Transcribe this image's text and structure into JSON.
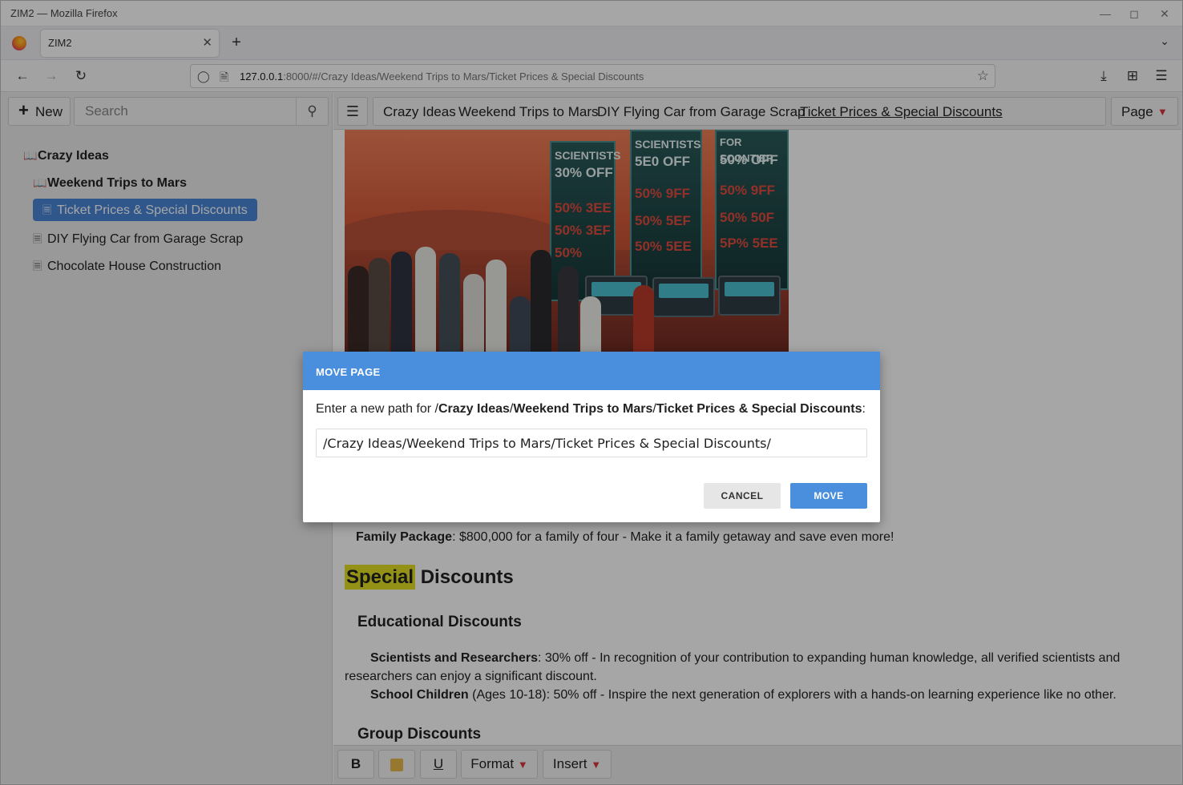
{
  "window": {
    "title": "ZIM2 — Mozilla Firefox"
  },
  "browser": {
    "tab_title": "ZIM2",
    "url_host": "127.0.0.1",
    "url_rest": ":8000/#/Crazy Ideas/Weekend Trips to Mars/Ticket Prices & Special Discounts"
  },
  "sidebar": {
    "new_label": "New",
    "search_placeholder": "Search",
    "tree": [
      {
        "label": "Crazy Ideas"
      },
      {
        "label": "Weekend Trips to Mars"
      },
      {
        "label": "Ticket Prices & Special Discounts"
      },
      {
        "label": "DIY Flying Car from Garage Scrap"
      },
      {
        "label": "Chocolate House Construction"
      }
    ]
  },
  "breadcrumbs": [
    "Crazy Ideas",
    "Weekend Trips to Mars",
    "DIY Flying Car from Garage Scrap",
    "Ticket Prices & Special Discounts"
  ],
  "page_menu_label": "Page",
  "hero_image": {
    "panels": [
      {
        "header": "SCIENTISTS",
        "lines": [
          "30% OFF",
          "50% 3EE",
          "50% 3EF",
          "50%"
        ]
      },
      {
        "header": "SCIENTISTS",
        "lines": [
          "5E0 OFF",
          "50% 9FF",
          "50% 5EF",
          "50% 5EE"
        ]
      },
      {
        "header": "FOR SCONTIER",
        "lines": [
          "50% OFF",
          "50% 9FF",
          "50% 50F",
          "5P% 5EE"
        ]
      }
    ]
  },
  "content": {
    "family_label": "Family Package",
    "family_text": ": $800,000 for a family of four - Make it a family getaway and save even more!",
    "h1_highlight": "Special",
    "h1_rest": " Discounts",
    "h2_edu": "Educational Discounts",
    "sci_label": "Scientists and Researchers",
    "sci_text": ": 30% off - In recognition of your contribution to expanding human knowledge, all verified scientists and researchers can enjoy a significant discount.",
    "school_label": "School Children",
    "school_text": " (Ages 10-18): 50% off - Inspire the next generation of explorers with a hands-on learning experience like no other.",
    "h2_group": "Group Discounts"
  },
  "toolbar": {
    "bold": "B",
    "underline": "U",
    "format": "Format",
    "insert": "Insert"
  },
  "dialog": {
    "title": "MOVE PAGE",
    "prompt_prefix": "Enter a new path for /",
    "prompt_p1": "Crazy Ideas",
    "prompt_sep1": "/",
    "prompt_p2": "Weekend Trips to Mars",
    "prompt_sep2": "/",
    "prompt_p3": "Ticket Prices & Special Discounts",
    "prompt_suffix": ":",
    "path_value": "/Crazy Ideas/Weekend Trips to Mars/Ticket Prices & Special Discounts/",
    "cancel": "CANCEL",
    "move": "MOVE"
  },
  "colors": {
    "accent": "#4a8ede",
    "selected_item": "#4a86d8",
    "highlight": "#e3e123",
    "caret": "#d9363e"
  }
}
